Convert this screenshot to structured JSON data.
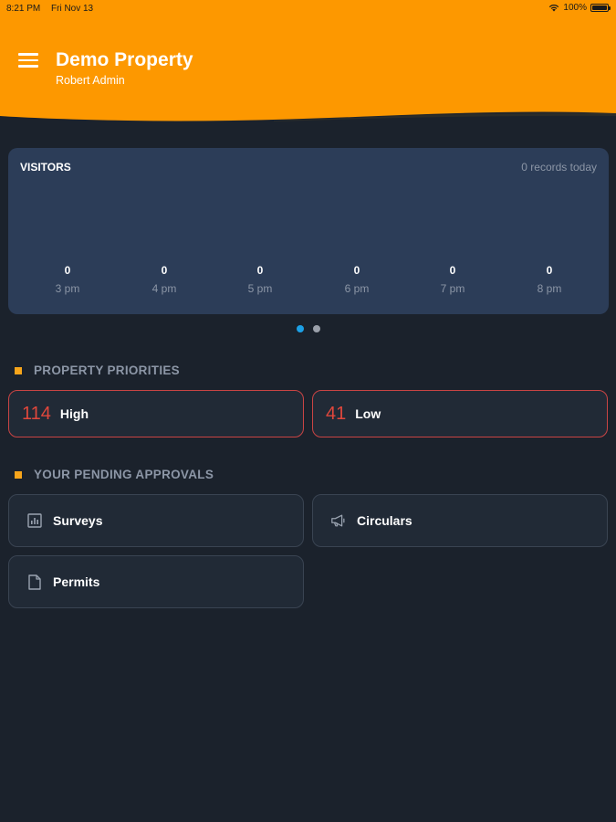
{
  "status_bar": {
    "time": "8:21 PM",
    "date": "Fri Nov 13",
    "battery": "100%"
  },
  "header": {
    "title": "Demo Property",
    "subtitle": "Robert Admin",
    "accent_color": "#fd9800"
  },
  "visitors": {
    "title": "VISITORS",
    "records": "0 records today",
    "hours": [
      {
        "value": "0",
        "label": "3 pm"
      },
      {
        "value": "0",
        "label": "4 pm"
      },
      {
        "value": "0",
        "label": "5 pm"
      },
      {
        "value": "0",
        "label": "6 pm"
      },
      {
        "value": "0",
        "label": "7 pm"
      },
      {
        "value": "0",
        "label": "8 pm"
      }
    ]
  },
  "pager": {
    "count": 2,
    "active": 0
  },
  "priorities": {
    "heading": "PROPERTY PRIORITIES",
    "items": [
      {
        "count": "114",
        "label": "High"
      },
      {
        "count": "41",
        "label": "Low"
      }
    ]
  },
  "approvals": {
    "heading": "YOUR PENDING APPROVALS",
    "items": [
      {
        "label": "Surveys",
        "icon": "bar-chart-icon"
      },
      {
        "label": "Circulars",
        "icon": "megaphone-icon"
      },
      {
        "label": "Permits",
        "icon": "document-icon"
      }
    ]
  }
}
